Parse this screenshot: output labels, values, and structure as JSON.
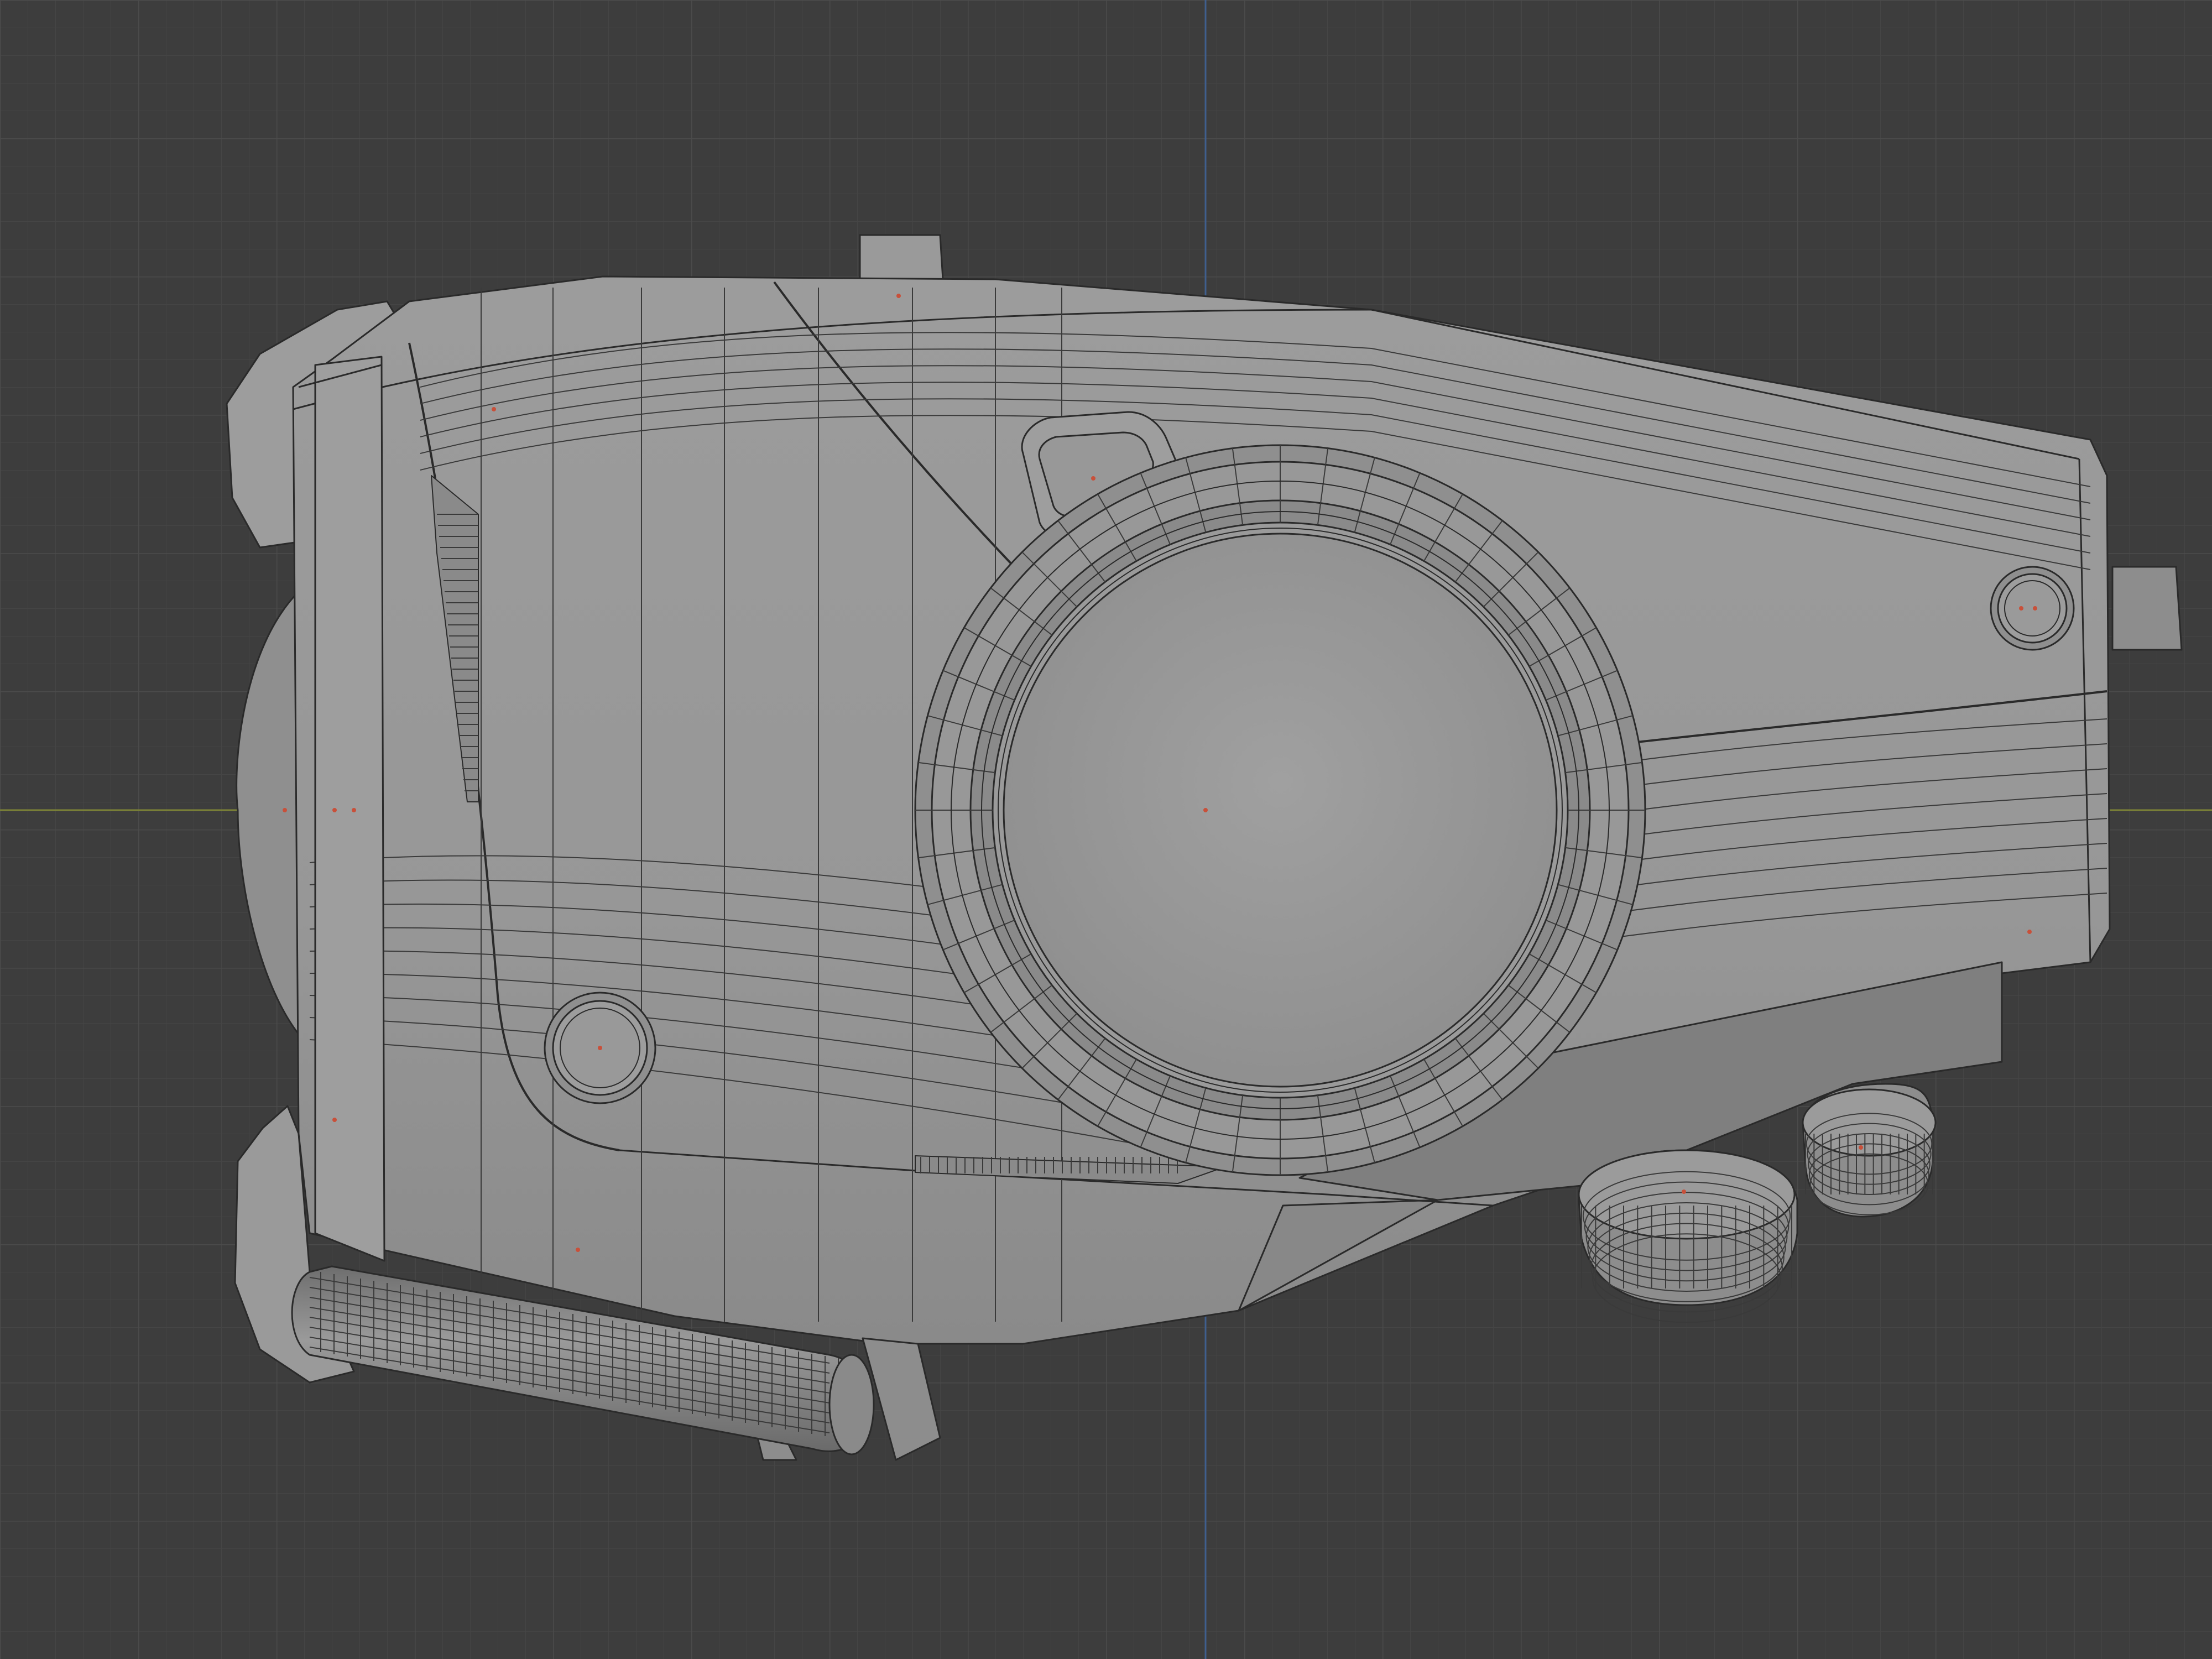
{
  "viewport": {
    "mode": "orthographic-view",
    "shading": "solid-wireframe-overlay",
    "colors": {
      "background": "#3d3d3d",
      "grid_minor": "#454545",
      "grid_major": "#4b4b4b",
      "axis_x": "#8a8f3a",
      "axis_y": "#3f5f8f",
      "mesh_fill": "#959595",
      "mesh_fill_light": "#a3a3a3",
      "mesh_fill_dark": "#7c7c7c",
      "edge": "#2a2a2a",
      "vertex_dot": "#c8503a"
    }
  },
  "object": {
    "name_icon": "mesh-object-icon",
    "parts": [
      "main-body",
      "front-lens-dome",
      "side-dial",
      "top-tab",
      "back-tab",
      "small-knob-front",
      "small-knob-back",
      "lower-handle",
      "lower-cylinders",
      "vent-grille-vertical",
      "vent-grille-horizontal",
      "small-screen-panel"
    ]
  }
}
